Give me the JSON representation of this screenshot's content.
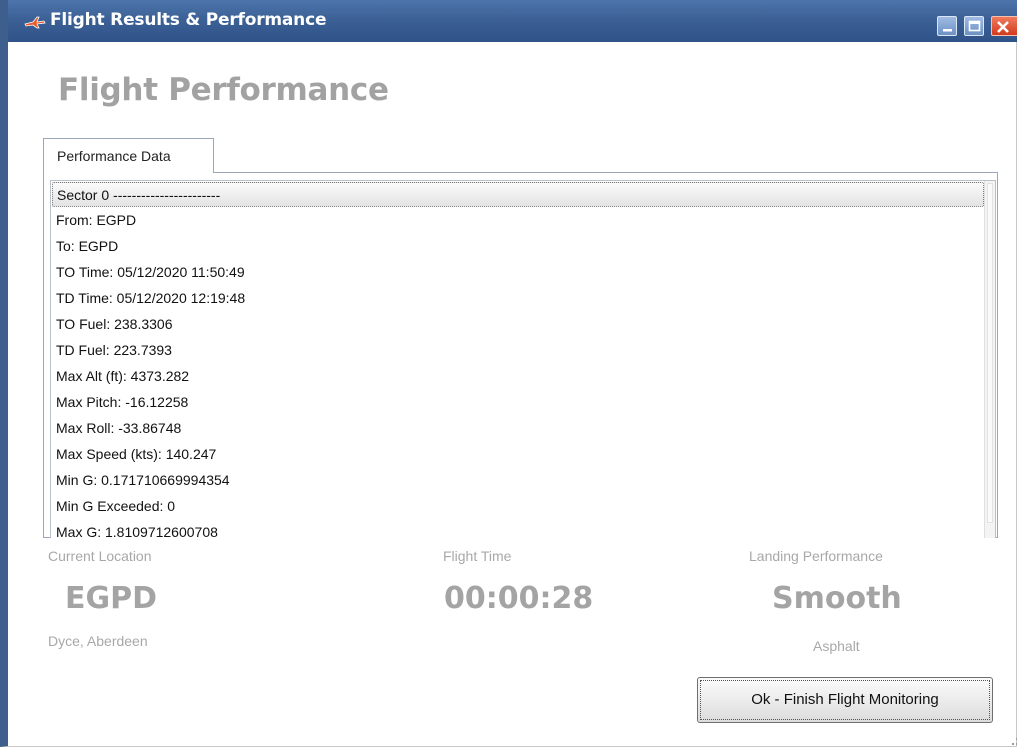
{
  "window": {
    "title": "Flight Results & Performance",
    "icon": "airplane-icon",
    "controls": [
      "minimize-icon",
      "maximize-icon",
      "close-icon"
    ],
    "accent_color": "#3c6196"
  },
  "main": {
    "heading": "Flight Performance",
    "tabs": [
      {
        "label": "Performance Data"
      }
    ],
    "performance_lines": [
      "Sector 0 -----------------------",
      "From: EGPD",
      "To: EGPD",
      "TO Time: 05/12/2020 11:50:49",
      "TD Time: 05/12/2020 12:19:48",
      "TO Fuel: 238.3306",
      "TD Fuel: 223.7393",
      "Max Alt (ft): 4373.282",
      "Max Pitch: -16.12258",
      "Max Roll: -33.86748",
      "Max Speed (kts): 140.247",
      "Min G: 0.171710669994354",
      "Min G Exceeded: 0",
      "Max G: 1.8109712600708"
    ]
  },
  "stats": {
    "location": {
      "label": "Current Location",
      "value": "EGPD",
      "sub": "Dyce, Aberdeen"
    },
    "flight_time": {
      "label": "Flight Time",
      "value": "00:00:28"
    },
    "landing": {
      "label": "Landing Performance",
      "value": "Smooth",
      "sub": "Asphalt"
    }
  },
  "actions": {
    "finish_label": "Ok - Finish Flight Monitoring"
  }
}
